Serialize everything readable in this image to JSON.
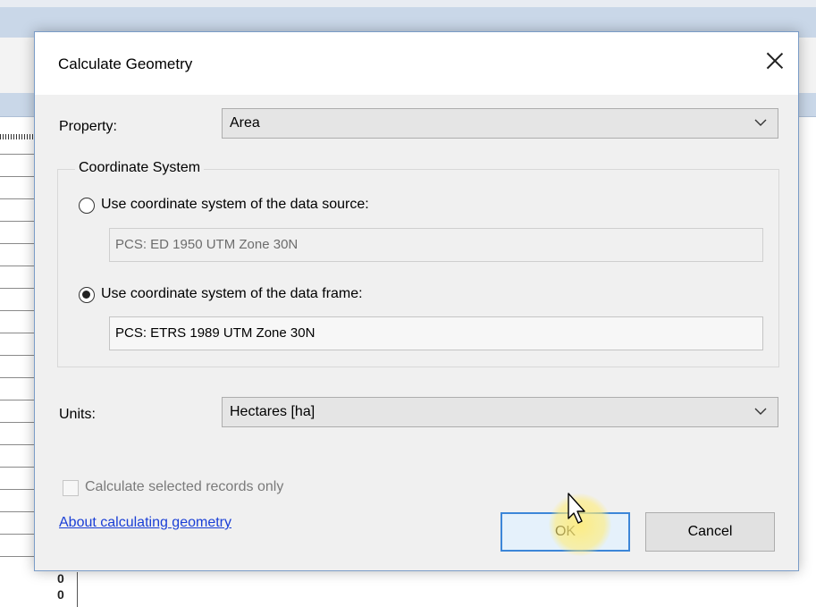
{
  "dialog": {
    "title": "Calculate Geometry",
    "property": {
      "label": "Property:",
      "value": "Area"
    },
    "coordinate_system": {
      "legend": "Coordinate System",
      "source": {
        "label": "Use coordinate system of the data source:",
        "value": "PCS: ED 1950 UTM Zone 30N",
        "selected": false
      },
      "frame": {
        "label": "Use coordinate system of the data frame:",
        "value": "PCS: ETRS 1989 UTM Zone 30N",
        "selected": true
      }
    },
    "units": {
      "label": "Units:",
      "value": "Hectares [ha]"
    },
    "selected_only": {
      "label": "Calculate selected records only",
      "checked": false,
      "enabled": false
    },
    "help_link": "About calculating geometry",
    "ok_label": "OK",
    "cancel_label": "Cancel"
  },
  "background": {
    "cells": [
      "0",
      "0"
    ]
  },
  "colors": {
    "dialog_bg": "#f0f0f0",
    "ok_border": "#3c86d8",
    "link": "#1a3fd6",
    "cursor_highlight": "#ffec78"
  }
}
